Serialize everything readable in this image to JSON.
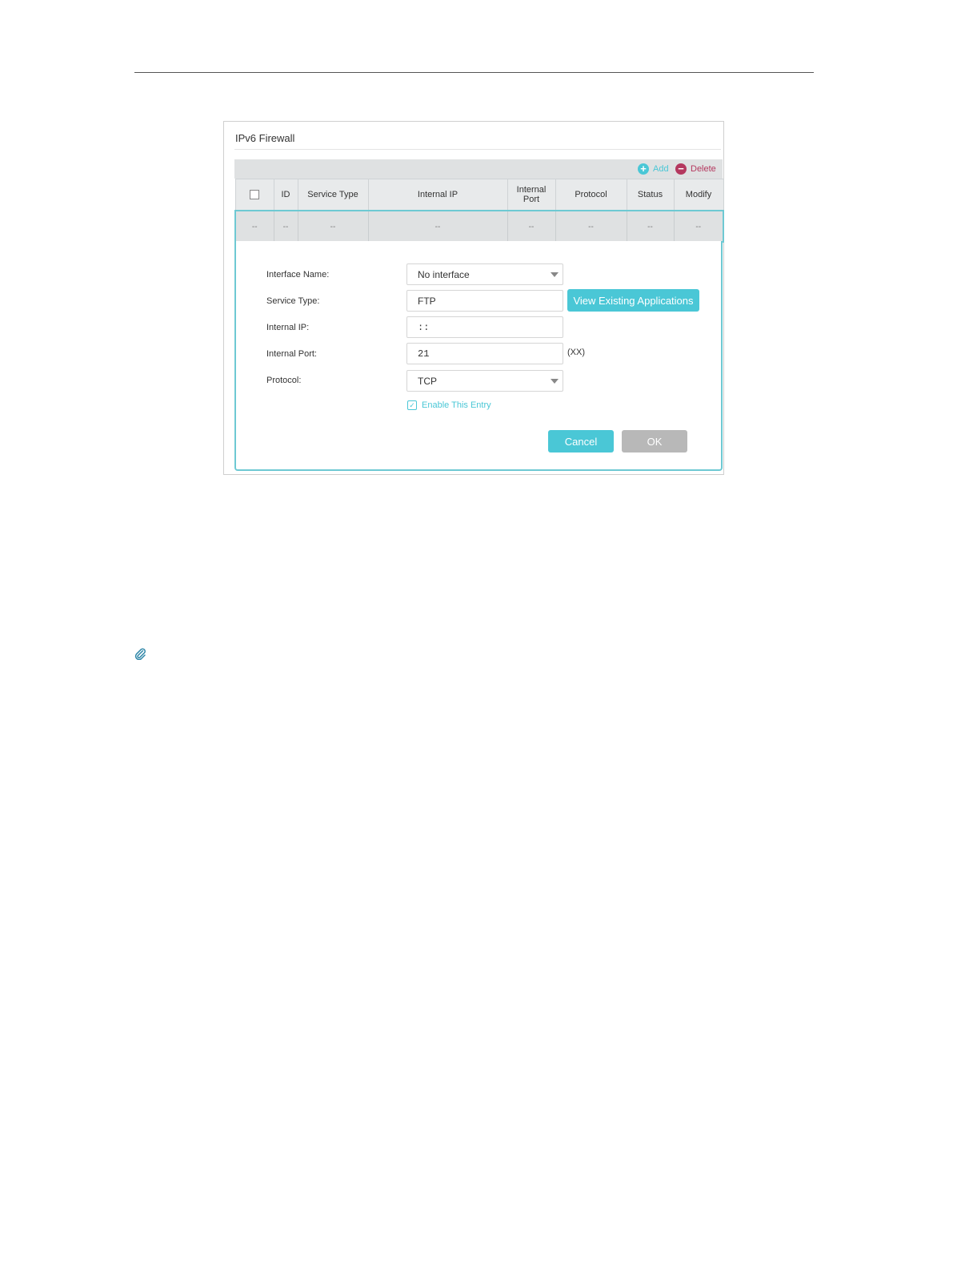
{
  "panel": {
    "title": "IPv6 Firewall"
  },
  "toolbar": {
    "add_label": "Add",
    "delete_label": "Delete"
  },
  "table": {
    "headers": [
      "ID",
      "Service Type",
      "Internal IP",
      "Internal Port",
      "Protocol",
      "Status",
      "Modify"
    ],
    "row": [
      "--",
      "--",
      "--",
      "--",
      "--",
      "--",
      "--",
      "--"
    ]
  },
  "form": {
    "interface_label": "Interface Name:",
    "interface_value": "No interface",
    "service_label": "Service Type:",
    "service_value": "FTP",
    "view_apps_label": "View Existing Applications",
    "ip_label": "Internal IP:",
    "ip_value": "::",
    "port_label": "Internal Port:",
    "port_value": "21",
    "port_hint": "(XX)",
    "protocol_label": "Protocol:",
    "protocol_value": "TCP",
    "enable_label": "Enable This Entry",
    "enable_checked": true,
    "cancel_label": "Cancel",
    "ok_label": "OK"
  },
  "colors": {
    "accent": "#4ac7d6",
    "delete": "#b4385f",
    "ok_disabled": "#b8b8b8"
  },
  "icons": [
    "plus-circle-icon",
    "minus-circle-icon",
    "chevron-down-icon",
    "check-icon",
    "paperclip-icon"
  ]
}
